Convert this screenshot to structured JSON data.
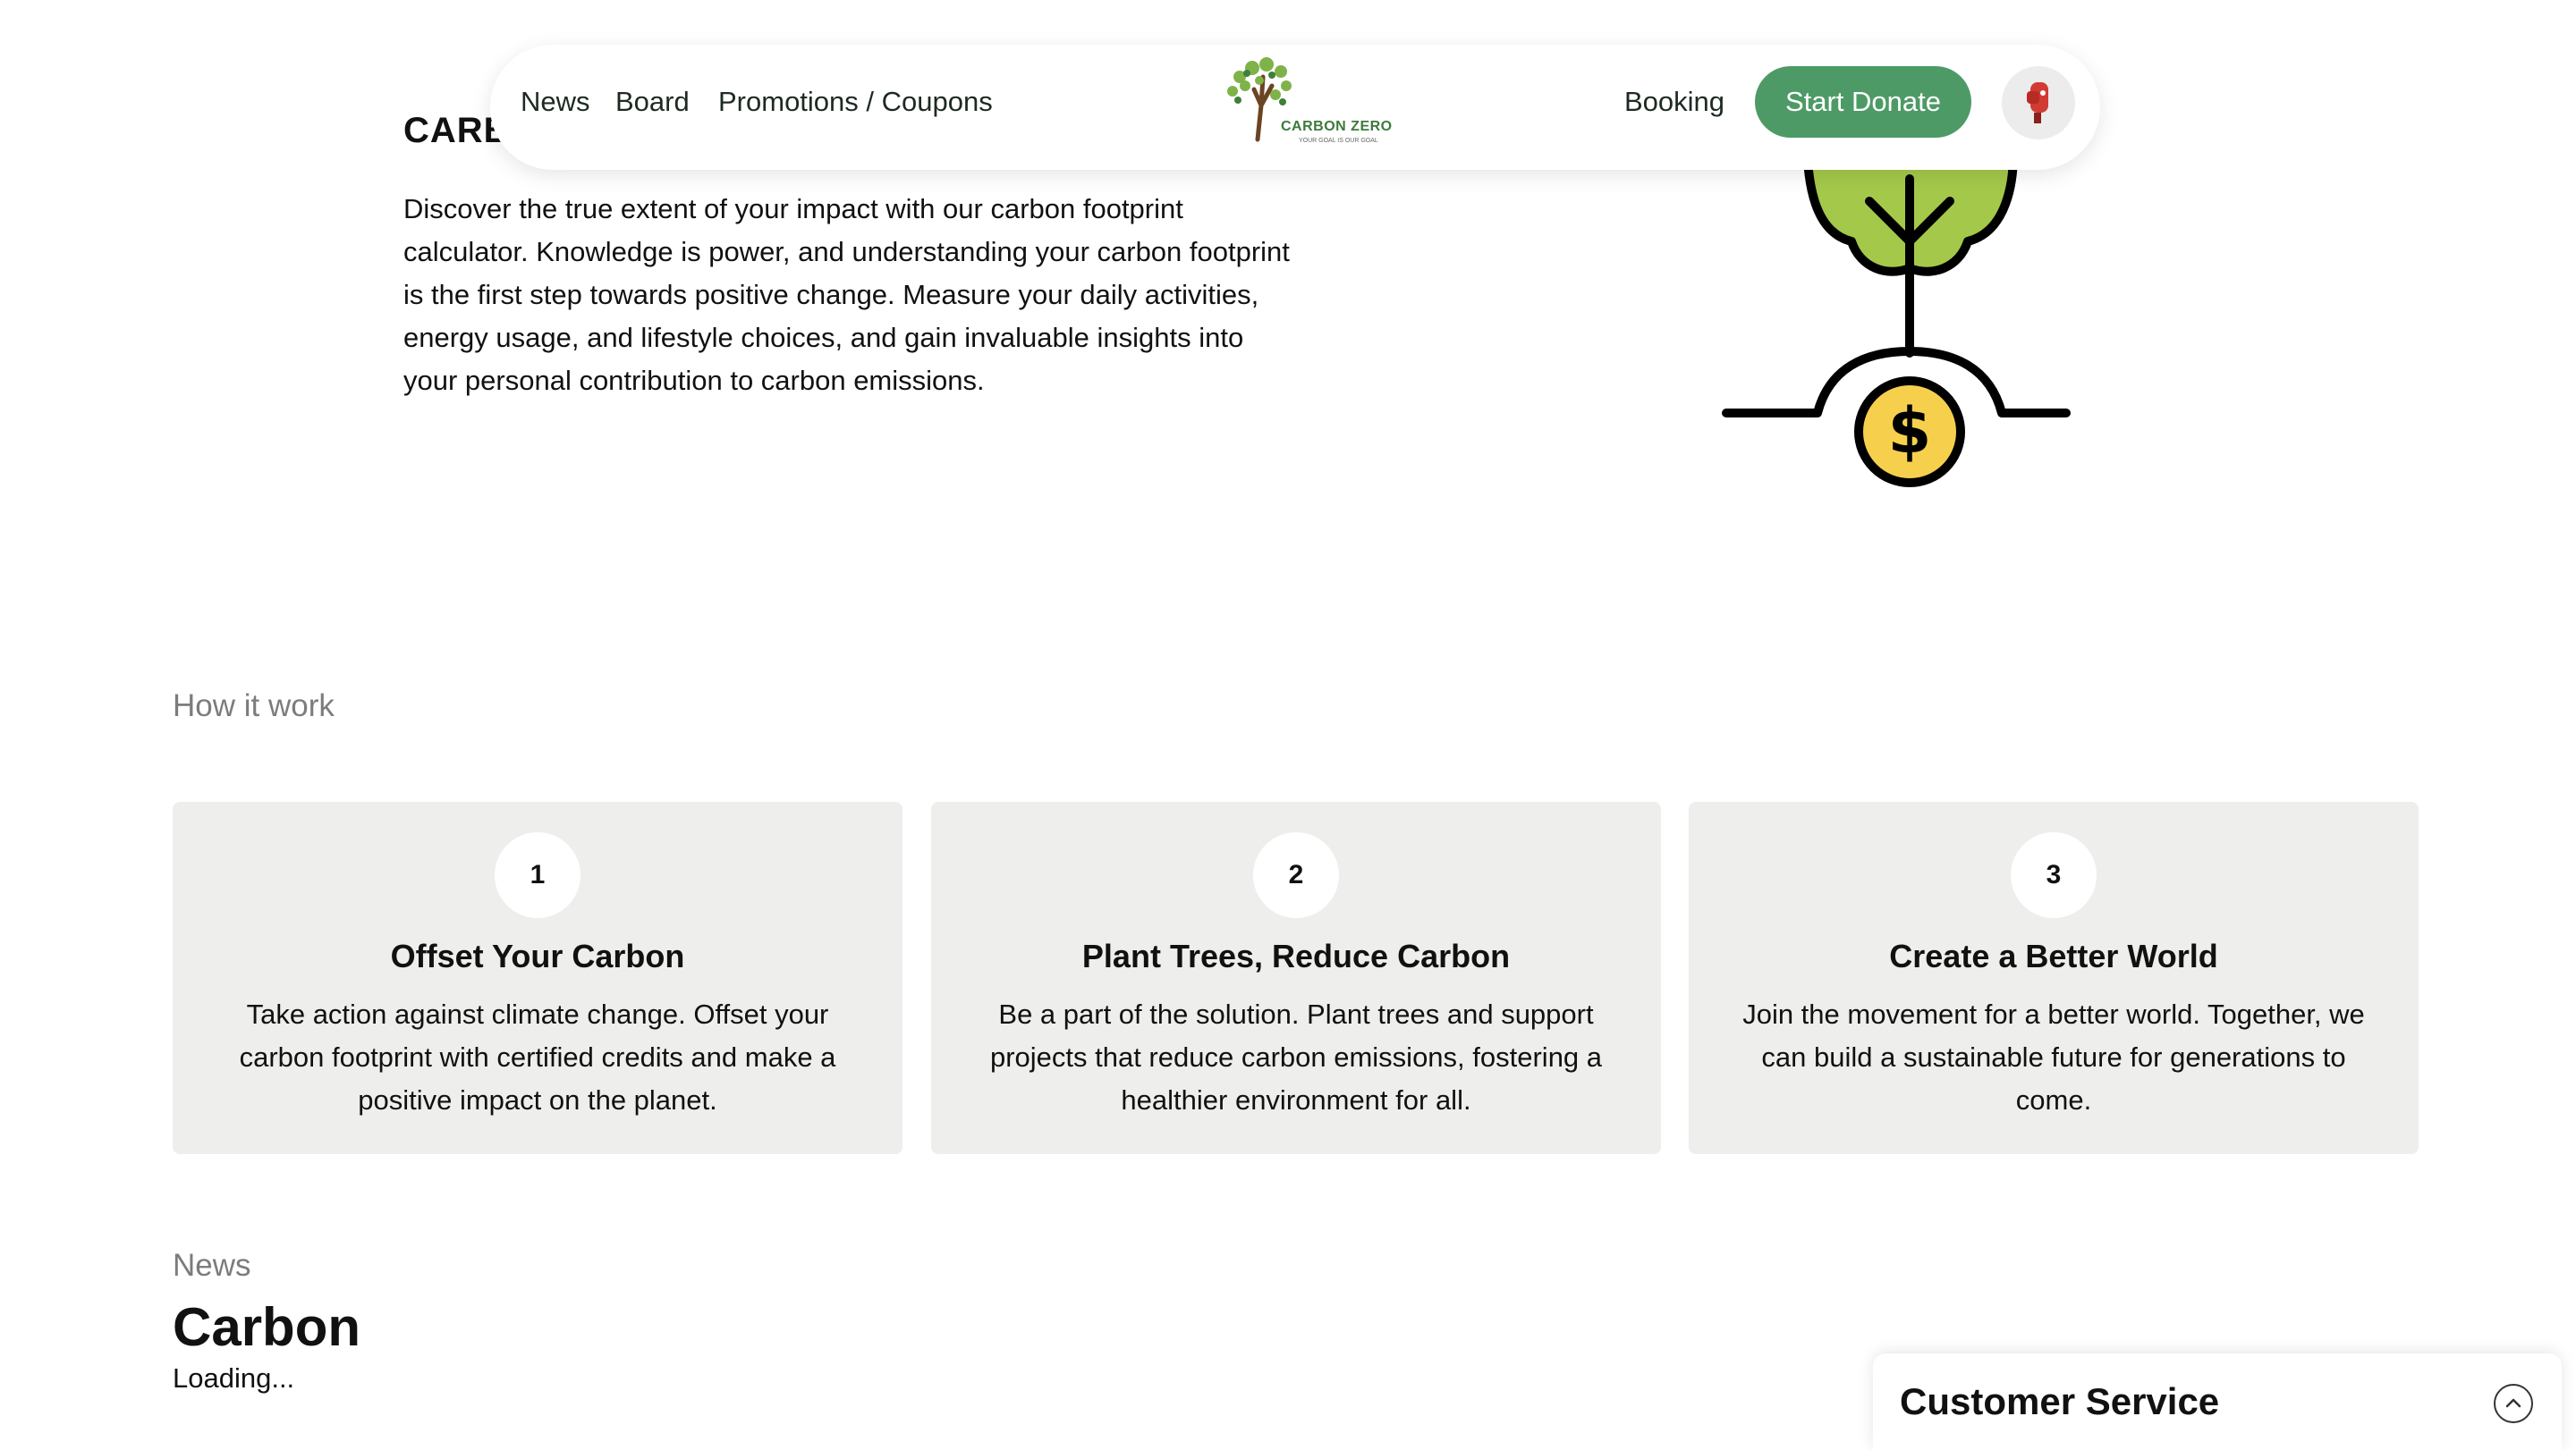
{
  "hero": {
    "title": "CARBO",
    "description": "Discover the true extent of your impact with our carbon footprint calculator. Knowledge is power, and understanding your carbon footprint is the first step towards positive change. Measure your daily activities, energy usage, and lifestyle choices, and gain invaluable insights into your personal contribution to carbon emissions.",
    "illustration_icon": "tree-coin-icon"
  },
  "nav": {
    "links": [
      "News",
      "Board",
      "Promotions / Coupons",
      "Booking"
    ],
    "logo_text": "CARBON ZERO",
    "logo_subtext": "YOUR GOAL IS OUR GOAL",
    "donate_label": "Start Donate",
    "avatar_icon": "user-avatar-icon"
  },
  "how_it_works": {
    "label": "How it work",
    "steps": [
      {
        "number": "1",
        "title": "Offset Your Carbon",
        "text": "Take action against climate change. Offset your carbon footprint with certified credits and make a positive impact on the planet."
      },
      {
        "number": "2",
        "title": "Plant Trees, Reduce Carbon",
        "text": "Be a part of the solution. Plant trees and support projects that reduce carbon emissions, fostering a healthier environment for all."
      },
      {
        "number": "3",
        "title": "Create a Better World",
        "text": "Join the movement for a better world. Together, we can build a sustainable future for generations to come."
      }
    ]
  },
  "news": {
    "label": "News",
    "heading": "Carbon",
    "status": "Loading..."
  },
  "customer_service": {
    "title": "Customer Service",
    "toggle_icon": "chevron-up-icon"
  },
  "colors": {
    "accent": "#4e9a67",
    "card_bg": "#eeeeec",
    "label_gray": "#7c7c7c",
    "tree_green": "#a4c94a",
    "coin_yellow": "#f6d04d"
  }
}
